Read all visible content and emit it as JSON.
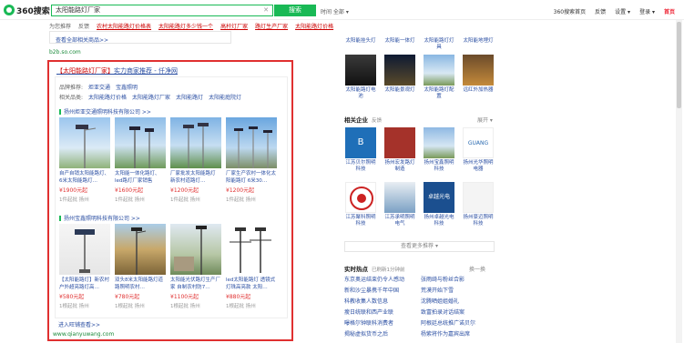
{
  "header": {
    "logo_text": "360搜索",
    "query": "太阳能路灯厂家",
    "search_button": "搜索",
    "time_filter": "时间 全部 ▾",
    "links": [
      "360搜索首页",
      "反馈",
      "设置 ▾",
      "登录 ▾",
      "首页"
    ]
  },
  "related": {
    "label": "为您推荐",
    "feedback": "反馈",
    "items": [
      "农村太阳能路灯价格表",
      "太阳能路灯多少钱一个",
      "高杆灯厂家",
      "路灯生产厂家",
      "太阳能路灯价格"
    ]
  },
  "left_panel": {
    "link_text": "查看全部相关商品>>",
    "domain": "b2b.so.com"
  },
  "ad": {
    "title_kw": "【太阳能路灯厂家】",
    "title_rest": "实力商家推荐 - 仟净网",
    "brand_label": "品牌推荐:",
    "brands": [
      "炬亚交通",
      "宝鑫照明"
    ],
    "cat_label": "相关品类:",
    "cats": [
      "太阳能路灯价格",
      "太阳能路灯厂家",
      "太阳能路灯",
      "太阳能庭院灯"
    ],
    "company1": "扬州炬亚交通照明科技有限公司 >>",
    "company2": "扬州宝鑫照明科技有限公司 >>",
    "products1": [
      {
        "name": "自产自销太阳能路灯、6米太阳能路灯…",
        "price": "¥1900元起",
        "meta": "1件起批  扬州"
      },
      {
        "name": "太阳能一体化路灯、led路灯厂家销售",
        "price": "¥1600元起",
        "meta": "1件起批  扬州"
      },
      {
        "name": "厂家批发太阳能路灯 新农村道路灯…",
        "price": "¥1200元起",
        "meta": "1件起批  扬州"
      },
      {
        "name": "厂家生产农村一体化太阳能路灯 6米30…",
        "price": "¥1200元起",
        "meta": "1件起批  扬州"
      }
    ],
    "products2": [
      {
        "name": "【太阳能路灯】新农村户外超亮路灯高…",
        "price": "¥580元起",
        "meta": "1根起批  扬州"
      },
      {
        "name": "双头8米太阳能路灯道路照明农村…",
        "price": "¥780元起",
        "meta": "1根起批  扬州"
      },
      {
        "name": "太阳能光伏路灯生产厂家 自制农村防7…",
        "price": "¥1100元起",
        "meta": "1根起批  扬州"
      },
      {
        "name": "led太阳能路灯 透镜式灯珠高亮款 太阳…",
        "price": "¥880元起",
        "meta": "1根起批  扬州"
      }
    ],
    "more": "进入旺铺查看>>",
    "domain": "www.qianyuwang.com"
  },
  "right": {
    "top_caps": [
      "太阳能挂头灯",
      "太阳能一体灯",
      "太阳能路灯灯具",
      "太阳能地埋灯"
    ],
    "row2_caps": [
      "太阳能路灯电池",
      "太阳能景观灯",
      "太阳能路灯配置",
      "远红外加热器"
    ],
    "company_title": "相关企业",
    "company_fb": "反馈",
    "company_expand": "展开 ▾",
    "companies_row1": [
      "江苏贝尔照明科技",
      "扬州宏发路灯制造",
      "扬州宝鑫照明科技",
      "扬州光华照明电器"
    ],
    "companies_row2": [
      "江苏聚科照明科技",
      "江苏承明照明电气",
      "扬州卓越光电科技",
      "扬州豪迈照明科技"
    ],
    "more_btn": "查看更多推荐 ▾",
    "hot_title": "实时热点",
    "hot_sub": "已刷新1分钟前",
    "hot_refresh": "换一换",
    "hot_items": [
      "东京奥运结束仍令人感动",
      "张雨绮与粉丝合影",
      "新和沙尘暴携千年中国",
      "荒漠开始下雪",
      "科教收集人数信息",
      "沈腾晒姐姐婚礼",
      "瘦日统联和西产业联",
      "致富拍录对话结案",
      "曝格尔钟联科消费者",
      "阿根廷总统推广诺贝尔",
      "揭秘虚拟货币之后",
      "杨紫将作为嘉宾出席"
    ]
  }
}
